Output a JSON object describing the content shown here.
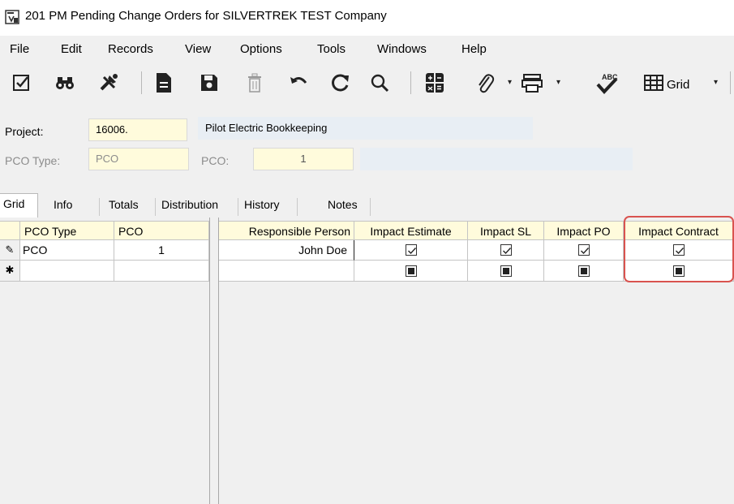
{
  "window": {
    "title": "201 PM Pending Change Orders for SILVERTREK TEST Company"
  },
  "menu": [
    "File",
    "Edit",
    "Records",
    "View",
    "Options",
    "Tools",
    "Windows",
    "Help"
  ],
  "toolbar": {
    "grid_label": "Grid"
  },
  "form": {
    "project_label": "Project:",
    "project_value": "16006.",
    "project_desc": "Pilot Electric Bookkeeping",
    "pco_type_label": "PCO Type:",
    "pco_type_value": "PCO",
    "pco_label": "PCO:",
    "pco_value": "1"
  },
  "tabs": [
    "Grid",
    "Info",
    "Totals",
    "Distribution",
    "History",
    "Notes"
  ],
  "grid": {
    "left_headers": [
      "PCO Type",
      "PCO"
    ],
    "right_headers": [
      "Responsible Person",
      "Impact Estimate",
      "Impact SL",
      "Impact PO",
      "Impact Contract"
    ],
    "rows": [
      {
        "pco_type": "PCO",
        "pco": "1",
        "responsible": "John Doe",
        "impact_estimate": "checked",
        "impact_sl": "checked",
        "impact_po": "checked",
        "impact_contract": "checked"
      },
      {
        "pco_type": "",
        "pco": "",
        "responsible": "",
        "impact_estimate": "indeterminate",
        "impact_sl": "indeterminate",
        "impact_po": "indeterminate",
        "impact_contract": "indeterminate"
      }
    ],
    "row_indicators": [
      "✎",
      "✱"
    ]
  }
}
